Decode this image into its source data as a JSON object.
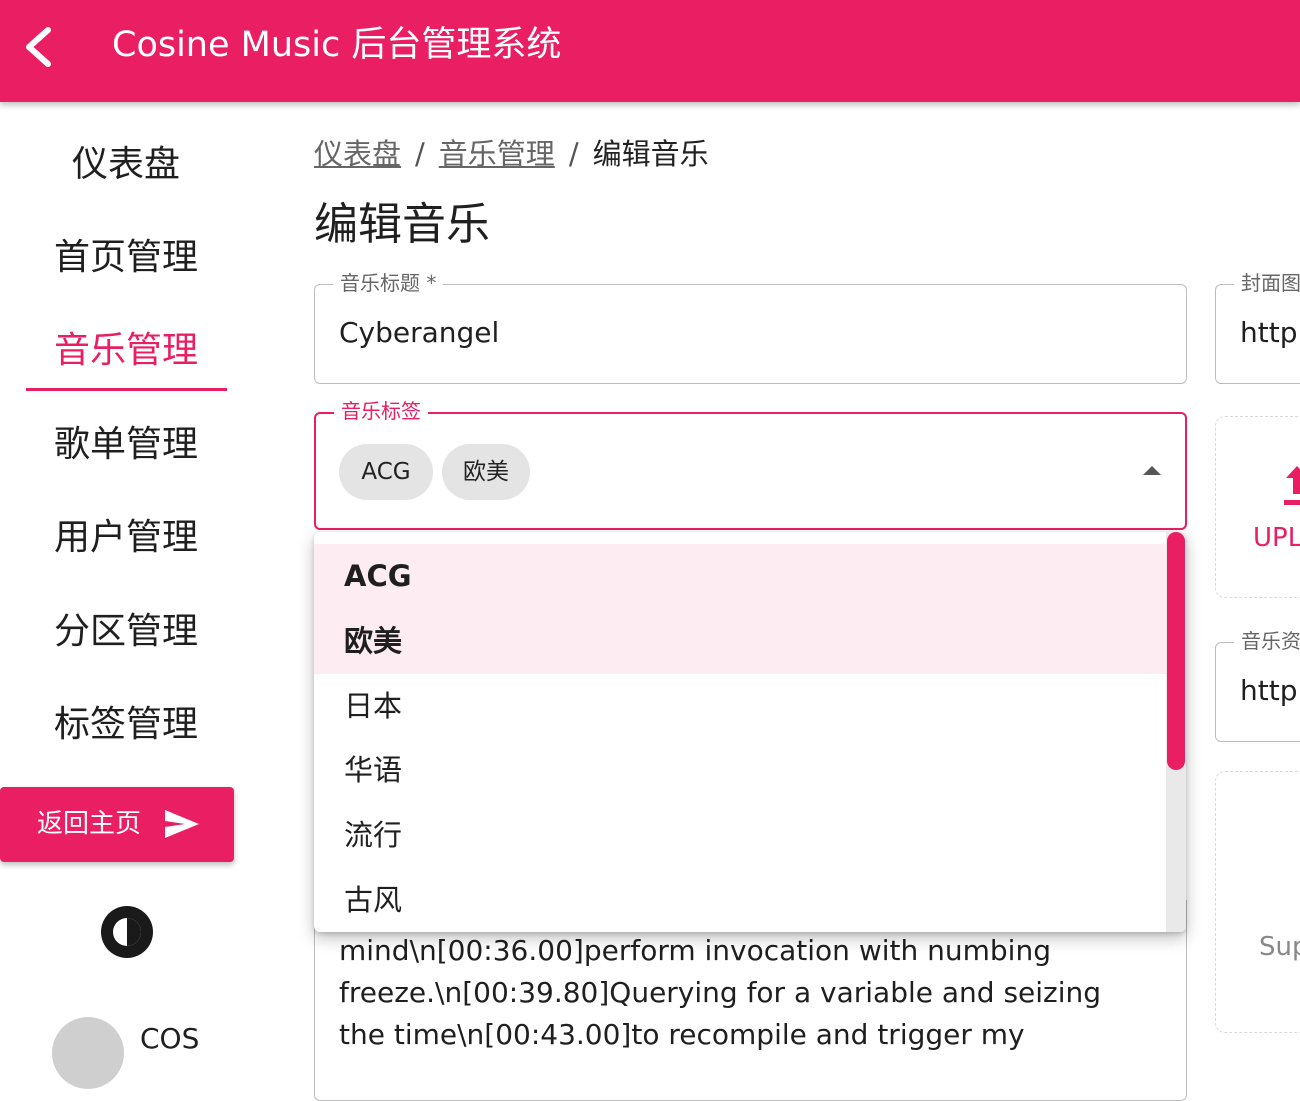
{
  "header": {
    "title": "Cosine Music 后台管理系统",
    "back_icon": "chevron-left-icon",
    "color": "#e91e63"
  },
  "sidebar": {
    "items": [
      {
        "label": "仪表盘",
        "active": false
      },
      {
        "label": "首页管理",
        "active": false
      },
      {
        "label": "音乐管理",
        "active": true
      },
      {
        "label": "歌单管理",
        "active": false
      },
      {
        "label": "用户管理",
        "active": false
      },
      {
        "label": "分区管理",
        "active": false
      },
      {
        "label": "标签管理",
        "active": false
      }
    ],
    "home_button": {
      "label": "返回主页",
      "icon": "send-icon"
    },
    "theme_icon": "theme-toggle-icon",
    "user_name": "COS"
  },
  "breadcrumb": {
    "items": [
      "仪表盘",
      "音乐管理"
    ],
    "separator": "/",
    "current": "编辑音乐"
  },
  "page_title": "编辑音乐",
  "form": {
    "title_field": {
      "label": "音乐标题 *",
      "value": "Cyberangel"
    },
    "tags_field": {
      "label": "音乐标签",
      "chips": [
        "ACG",
        "欧美"
      ]
    },
    "cover_field": {
      "label": "封面图",
      "value": "http:/"
    },
    "upload": {
      "label": "UPL",
      "icon": "upload-icon"
    },
    "source_field": {
      "label": "音乐资",
      "value": "http:/"
    },
    "upload2": {
      "text": "Sup"
    },
    "lyrics_text": "mind\\n[00:36.00]perform invocation with numbing freeze.\\n[00:39.80]Querying for a variable and seizing the time\\n[00:43.00]to recompile and trigger my"
  },
  "dropdown": {
    "options": [
      {
        "label": "ACG",
        "selected": true
      },
      {
        "label": "欧美",
        "selected": true
      },
      {
        "label": "日本",
        "selected": false
      },
      {
        "label": "华语",
        "selected": false
      },
      {
        "label": "流行",
        "selected": false
      },
      {
        "label": "古风",
        "selected": false
      }
    ],
    "accent": "#e91e63",
    "selected_bg": "#fdecf1"
  }
}
